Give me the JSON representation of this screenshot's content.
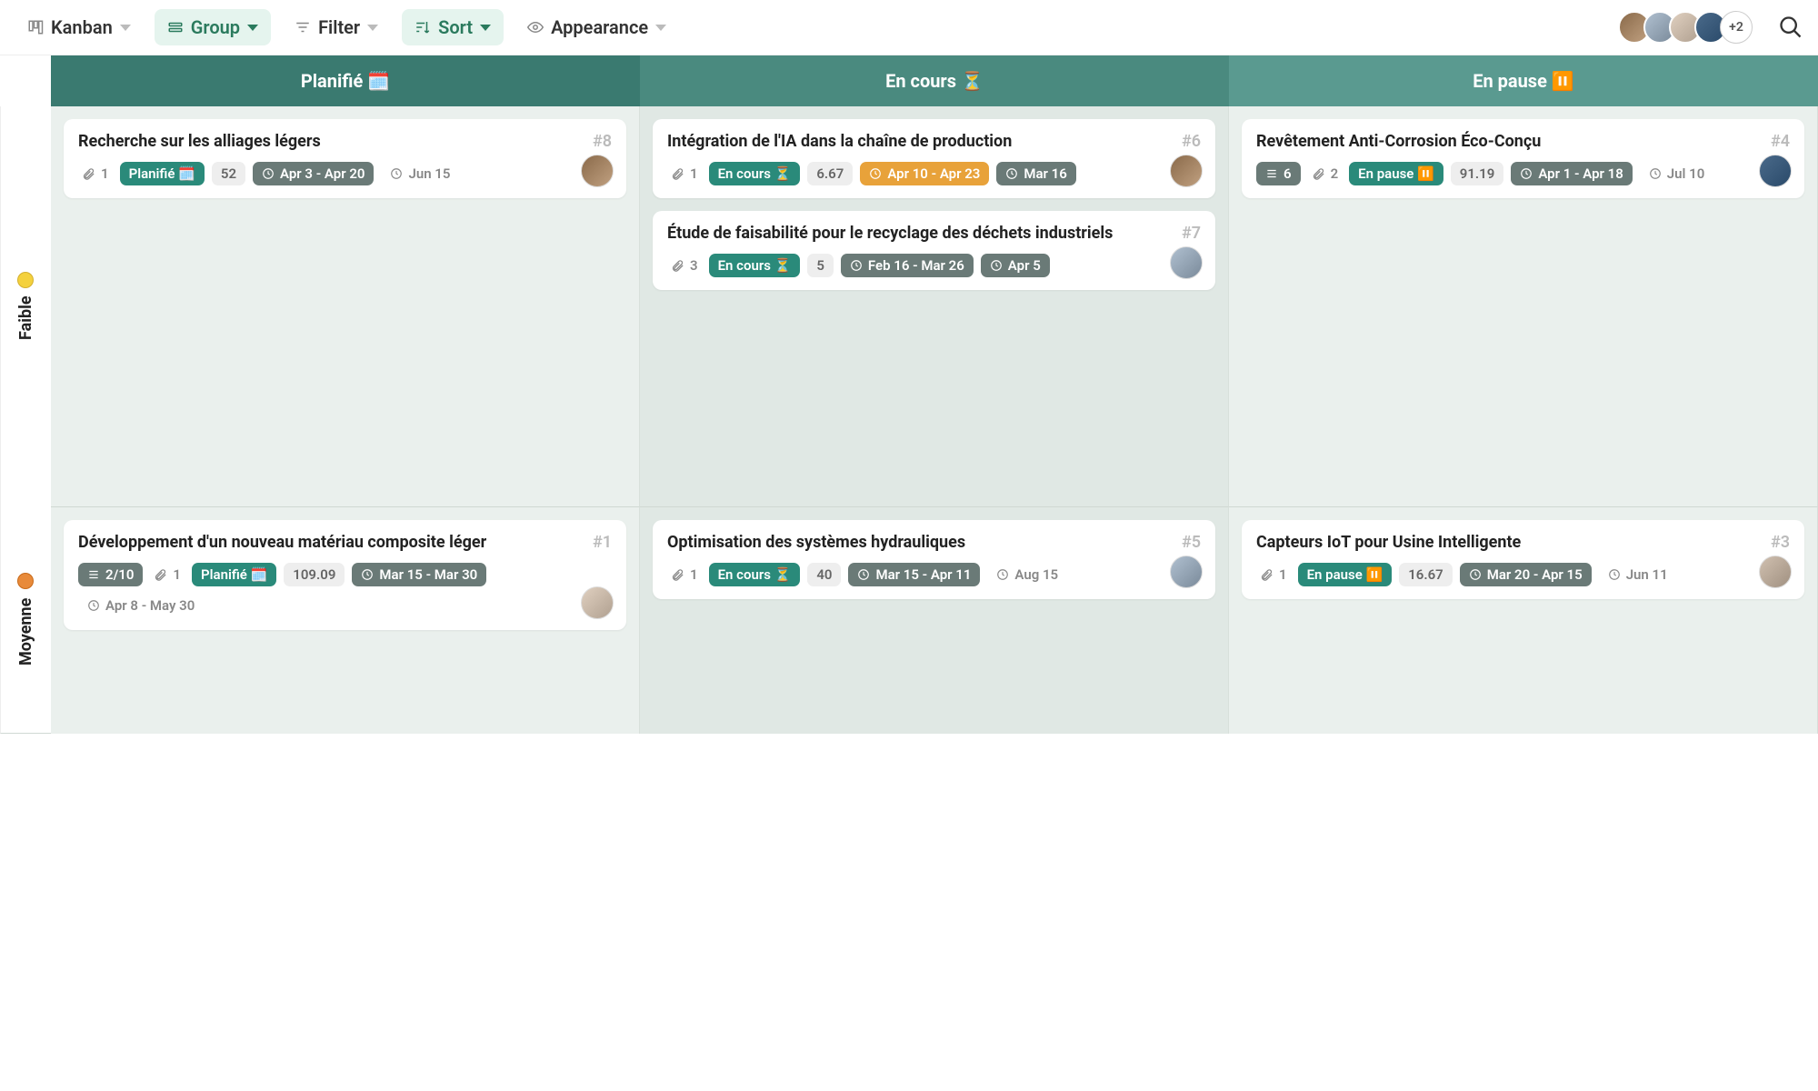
{
  "toolbar": {
    "view": "Kanban",
    "group": "Group",
    "filter": "Filter",
    "sort": "Sort",
    "appearance": "Appearance",
    "more_avatars": "+2"
  },
  "columns": [
    "Planifié 🗓️",
    "En cours ⏳",
    "En pause ⏸️"
  ],
  "lanes": [
    {
      "label": "Faible",
      "color": "yellow"
    },
    {
      "label": "Moyenne",
      "color": "orange"
    }
  ],
  "cards": {
    "faible_planifie": [
      {
        "title": "Recherche sur les alliages légers",
        "id": "#8",
        "attach": "1",
        "status": {
          "text": "Planifié 🗓️",
          "cls": "teal"
        },
        "score": "52",
        "range": {
          "text": "Apr 3 - Apr 20",
          "cls": "darkgrey"
        },
        "due": "Jun 15",
        "avatar": "av-a"
      }
    ],
    "faible_encours": [
      {
        "title": "Intégration de l'IA dans la chaîne de production",
        "id": "#6",
        "attach": "1",
        "status": {
          "text": "En cours ⏳",
          "cls": "teal"
        },
        "score": "6.67",
        "range": {
          "text": "Apr 10 - Apr 23",
          "cls": "orange"
        },
        "due": "Mar 16",
        "due_cls": "darkgrey",
        "avatar": "av-a"
      },
      {
        "title": "Étude de faisabilité pour le recyclage des déchets industriels",
        "id": "#7",
        "attach": "3",
        "status": {
          "text": "En cours ⏳",
          "cls": "teal"
        },
        "score": "5",
        "range": {
          "text": "Feb 16 - Mar 26",
          "cls": "darkgrey"
        },
        "due": "Apr 5",
        "due_cls": "darkgrey",
        "avatar": "av-b"
      }
    ],
    "faible_pause": [
      {
        "title": "Revêtement Anti-Corrosion Éco-Conçu",
        "id": "#4",
        "sub": "6",
        "attach": "2",
        "status": {
          "text": "En pause ⏸️",
          "cls": "teal"
        },
        "score": "91.19",
        "range": {
          "text": "Apr 1 - Apr 18",
          "cls": "darkgrey"
        },
        "due": "Jul 10",
        "avatar": "av-d"
      }
    ],
    "moy_planifie": [
      {
        "title": "Développement d'un nouveau matériau composite léger",
        "id": "#1",
        "sub": "2/10",
        "attach": "1",
        "status": {
          "text": "Planifié 🗓️",
          "cls": "teal"
        },
        "score": "109.09",
        "range": {
          "text": "Mar 15 - Mar 30",
          "cls": "darkgrey"
        },
        "due": "Apr 8 - May 30",
        "avatar": "av-c"
      }
    ],
    "moy_encours": [
      {
        "title": "Optimisation des systèmes hydrauliques",
        "id": "#5",
        "attach": "1",
        "status": {
          "text": "En cours ⏳",
          "cls": "teal"
        },
        "score": "40",
        "range": {
          "text": "Mar 15 - Apr 11",
          "cls": "darkgrey"
        },
        "due": "Aug 15",
        "avatar": "av-b"
      }
    ],
    "moy_pause": [
      {
        "title": "Capteurs IoT pour Usine Intelligente",
        "id": "#3",
        "attach": "1",
        "status": {
          "text": "En pause ⏸️",
          "cls": "teal"
        },
        "score": "16.67",
        "range": {
          "text": "Mar 20 - Apr 15",
          "cls": "darkgrey"
        },
        "due": "Jun 11",
        "avatar": "av-e"
      }
    ]
  }
}
